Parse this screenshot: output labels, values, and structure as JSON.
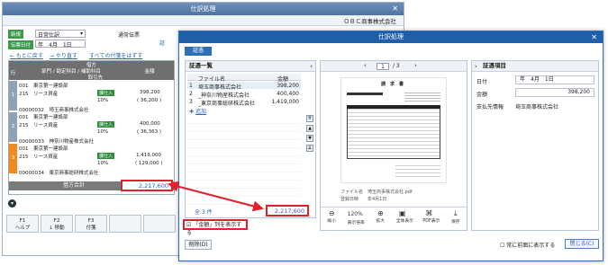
{
  "back_window": {
    "title": "仕訳処理",
    "company": "ＯＢＣ商事株式会社",
    "tag_new": "新規",
    "journal_type": "日常仕訳",
    "slip_type": "通常伝票",
    "date_tag": "伝票日付",
    "date_value": "年　4月　1日",
    "link_prev": "← もとに戻す",
    "link_next": "→ やり直す",
    "link_delete": "すべての付箋をはずす",
    "grid_header_credit": "借方",
    "grid_header_cols": [
      "行",
      "部門 / 勘定科目 / 補助科目",
      "金額"
    ],
    "grid_header_sub": "取引先",
    "rows": [
      {
        "num": "1",
        "dept": "001　東京第一建設部",
        "account": "215　リース資産",
        "tax": "課仕入",
        "amount": "398,200",
        "rate": "10%",
        "sub_amount": "( 36,200 )",
        "partner": "00000032　埼玉商事株式会社"
      },
      {
        "num": "2",
        "dept": "001　東京第一建設部",
        "account": "215　リース資産",
        "tax": "課仕入",
        "amount": "400,000",
        "rate": "10%",
        "sub_amount": "( 36,363 )",
        "partner": "00000033　神奈川物産株式会社"
      },
      {
        "num": "3",
        "dept": "001　東京第一建設部",
        "account": "215　リース資産",
        "tax": "課仕入",
        "amount": "1,419,000",
        "rate": "10%",
        "sub_amount": "( 129,000 )",
        "partner": "00000034　東京商事総研株式会社"
      }
    ],
    "total_label": "借方合計",
    "total_value": "2,217,600",
    "fkeys": [
      {
        "key": "F1",
        "label": "ヘルプ"
      },
      {
        "key": "F2",
        "label": "↓ 移動"
      },
      {
        "key": "F3",
        "label": "付箋"
      },
      {
        "key": "",
        "label": ""
      },
      {
        "key": "",
        "label": ""
      },
      {
        "key": "",
        "label": ""
      },
      {
        "key": "",
        "label": ""
      },
      {
        "key": "",
        "label": ""
      }
    ]
  },
  "front_window": {
    "title": "仕訳処理",
    "tab": "証憑",
    "list_panel": {
      "title": "証憑一覧",
      "columns": [
        "ファイル名",
        "金額"
      ],
      "rows": [
        {
          "num": "1",
          "name": "埼玉商事株式会社",
          "amount": "398,200"
        },
        {
          "num": "2",
          "name": "_神奈川物産株式会社",
          "amount": "400,400"
        },
        {
          "num": "3",
          "name": "_東京商事総研株式会社",
          "amount": "1,419,000"
        }
      ],
      "add_label": "追加",
      "count_label": "全 3 件",
      "total_value": "2,217,600",
      "checkbox_label": "「金額」列を表示する"
    },
    "viewer": {
      "page_current": "1",
      "page_total": "/ 3",
      "doc_title": "請　求　書",
      "filename_label": "ファイル名",
      "filename_value": "埼玉商事株式会社.pdf",
      "date_label": "登録日時",
      "date_value": "年4月1日",
      "tool_zoom": "120%",
      "tools": [
        "縮小",
        "表示倍率",
        "拡大",
        "全体表示",
        "PDF表示",
        "保存"
      ]
    },
    "info_panel": {
      "title": "証憑項目",
      "items": [
        {
          "label": "日付",
          "value": "年　4月　1日"
        },
        {
          "label": "金額",
          "value": "398,200"
        },
        {
          "label": "支払先情報",
          "value": "埼玉商事株式会社"
        }
      ]
    },
    "bottom": {
      "delete_label": "削除(D)",
      "front_checkbox": "常に前面に表示する",
      "close_label": "閉じる(C)"
    }
  },
  "colors": {
    "accent_red": "#e0202a",
    "title_blue": "#1f5ea8",
    "green_tag": "#3a9a49"
  }
}
